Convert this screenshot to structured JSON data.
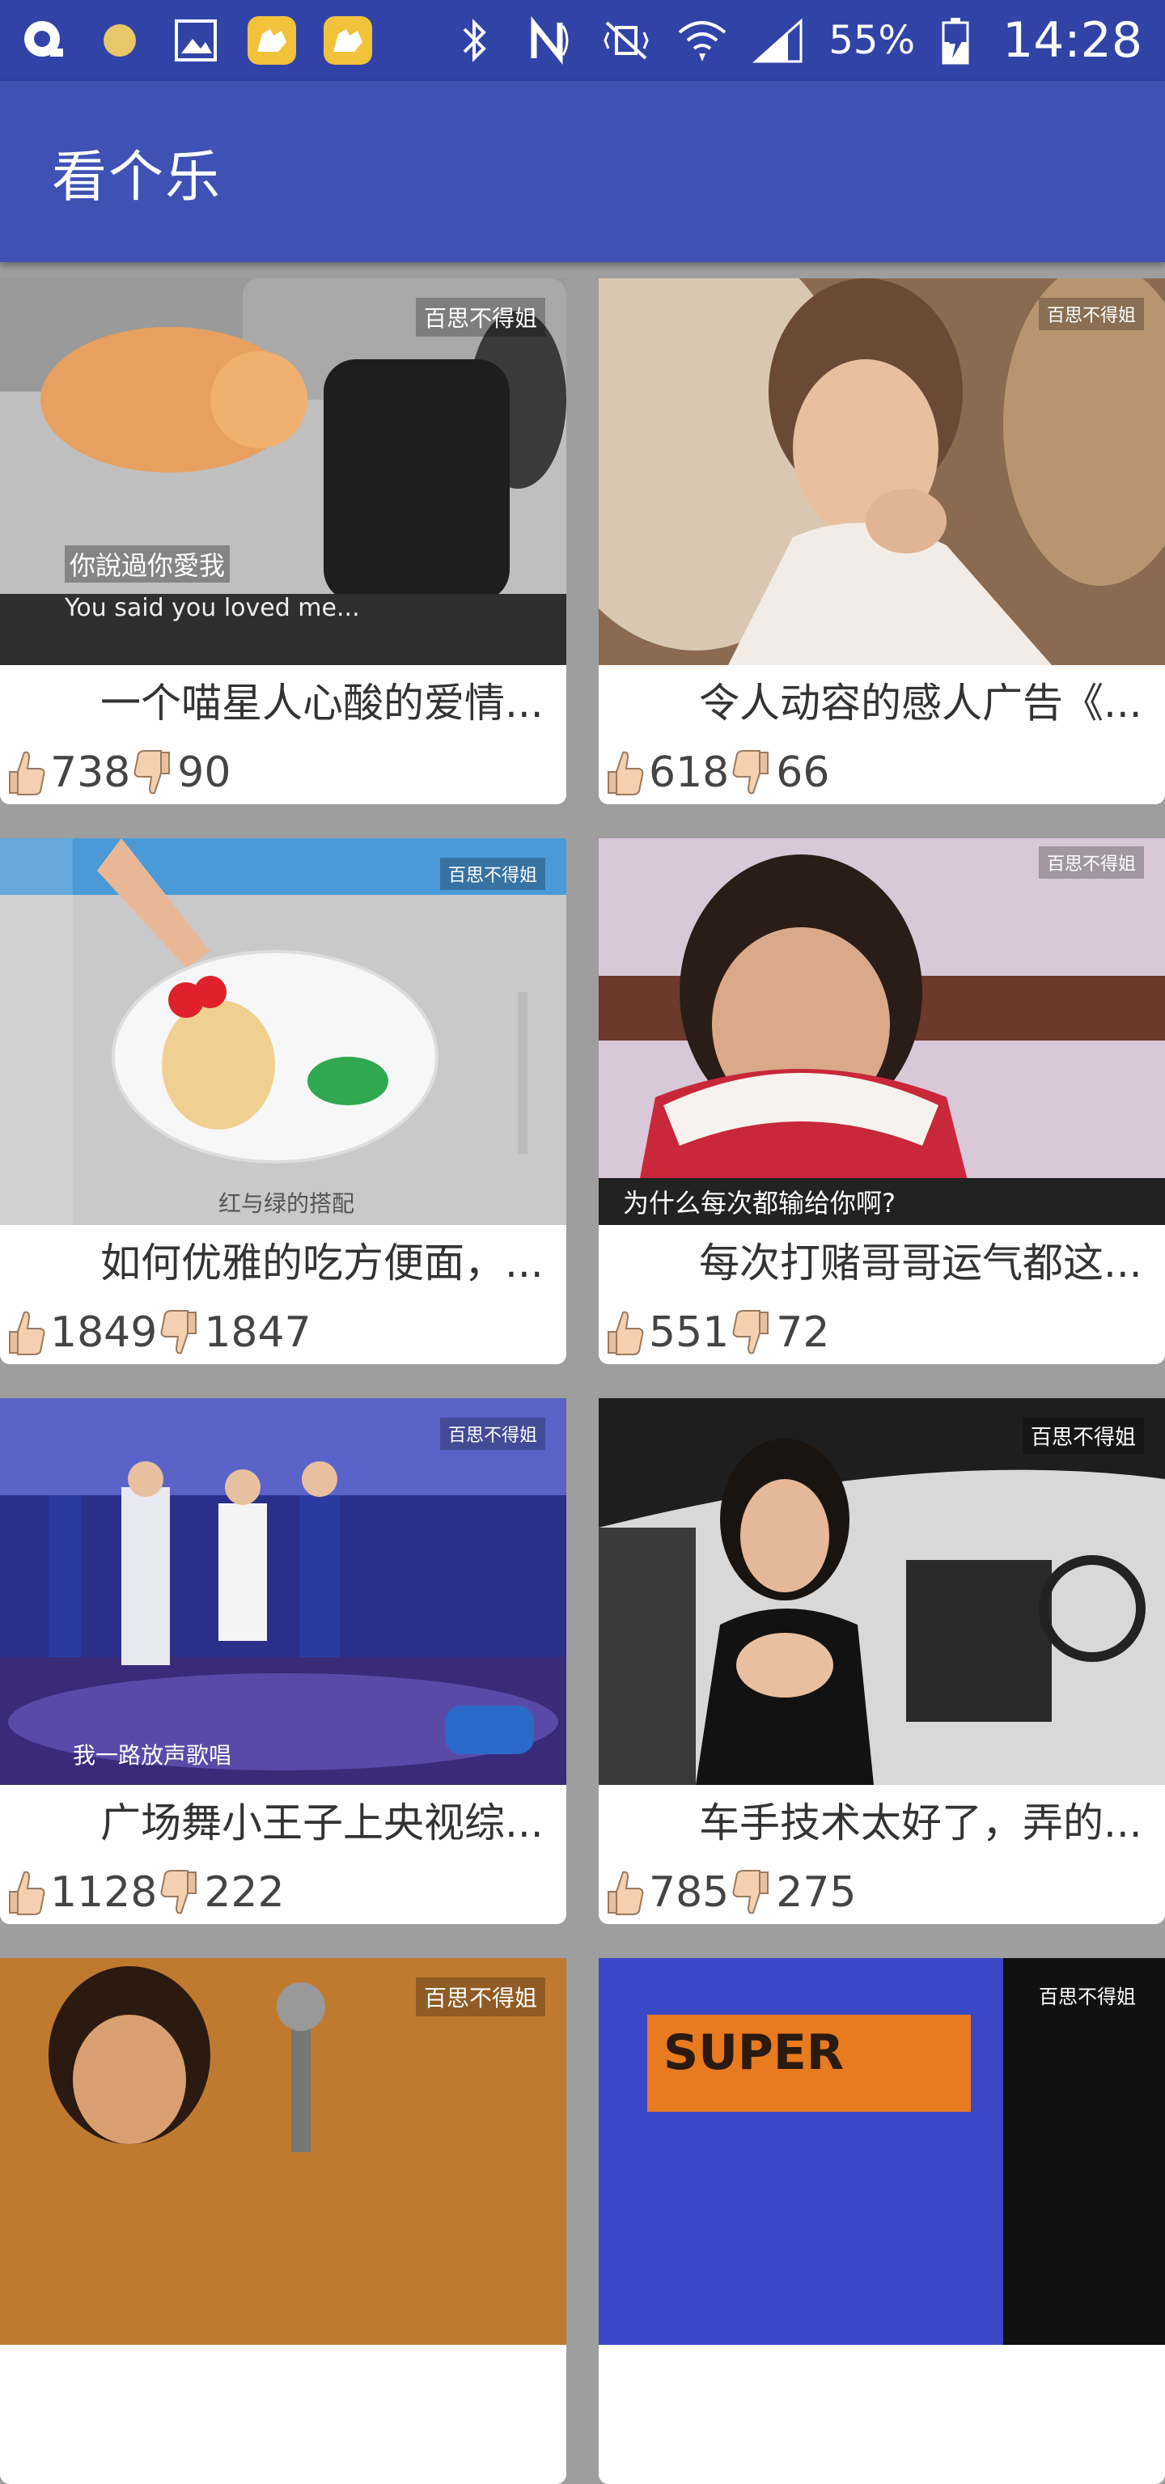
{
  "status_bar": {
    "battery": "55%",
    "time": "14:28"
  },
  "app_bar": {
    "title": "看个乐"
  },
  "cards": [
    {
      "title": "一个喵星人心酸的爱情...",
      "likes": "738",
      "dislikes": "90",
      "watermark": "百思不得姐",
      "caption_cn": "你說過你愛我",
      "caption_en": "You said you loved me..."
    },
    {
      "title": "令人动容的感人广告《...",
      "likes": "618",
      "dislikes": "66",
      "watermark": "百思不得姐"
    },
    {
      "title": "如何优雅的吃方便面，...",
      "likes": "1849",
      "dislikes": "1847",
      "watermark": "百思不得姐",
      "caption_cn": "红与绿的搭配"
    },
    {
      "title": "每次打赌哥哥运气都这...",
      "likes": "551",
      "dislikes": "72",
      "watermark": "百思不得姐",
      "caption_cn": "为什么每次都输给你啊?"
    },
    {
      "title": "广场舞小王子上央视综...",
      "likes": "1128",
      "dislikes": "222",
      "watermark": "百思不得姐",
      "caption_cn": "我一路放声歌唱"
    },
    {
      "title": "车手技术太好了，弄的...",
      "likes": "785",
      "dislikes": "275",
      "watermark": "百思不得姐"
    },
    {
      "watermark": "百思不得姐"
    },
    {
      "watermark": "百思不得姐",
      "game_text": "SUPER"
    }
  ]
}
